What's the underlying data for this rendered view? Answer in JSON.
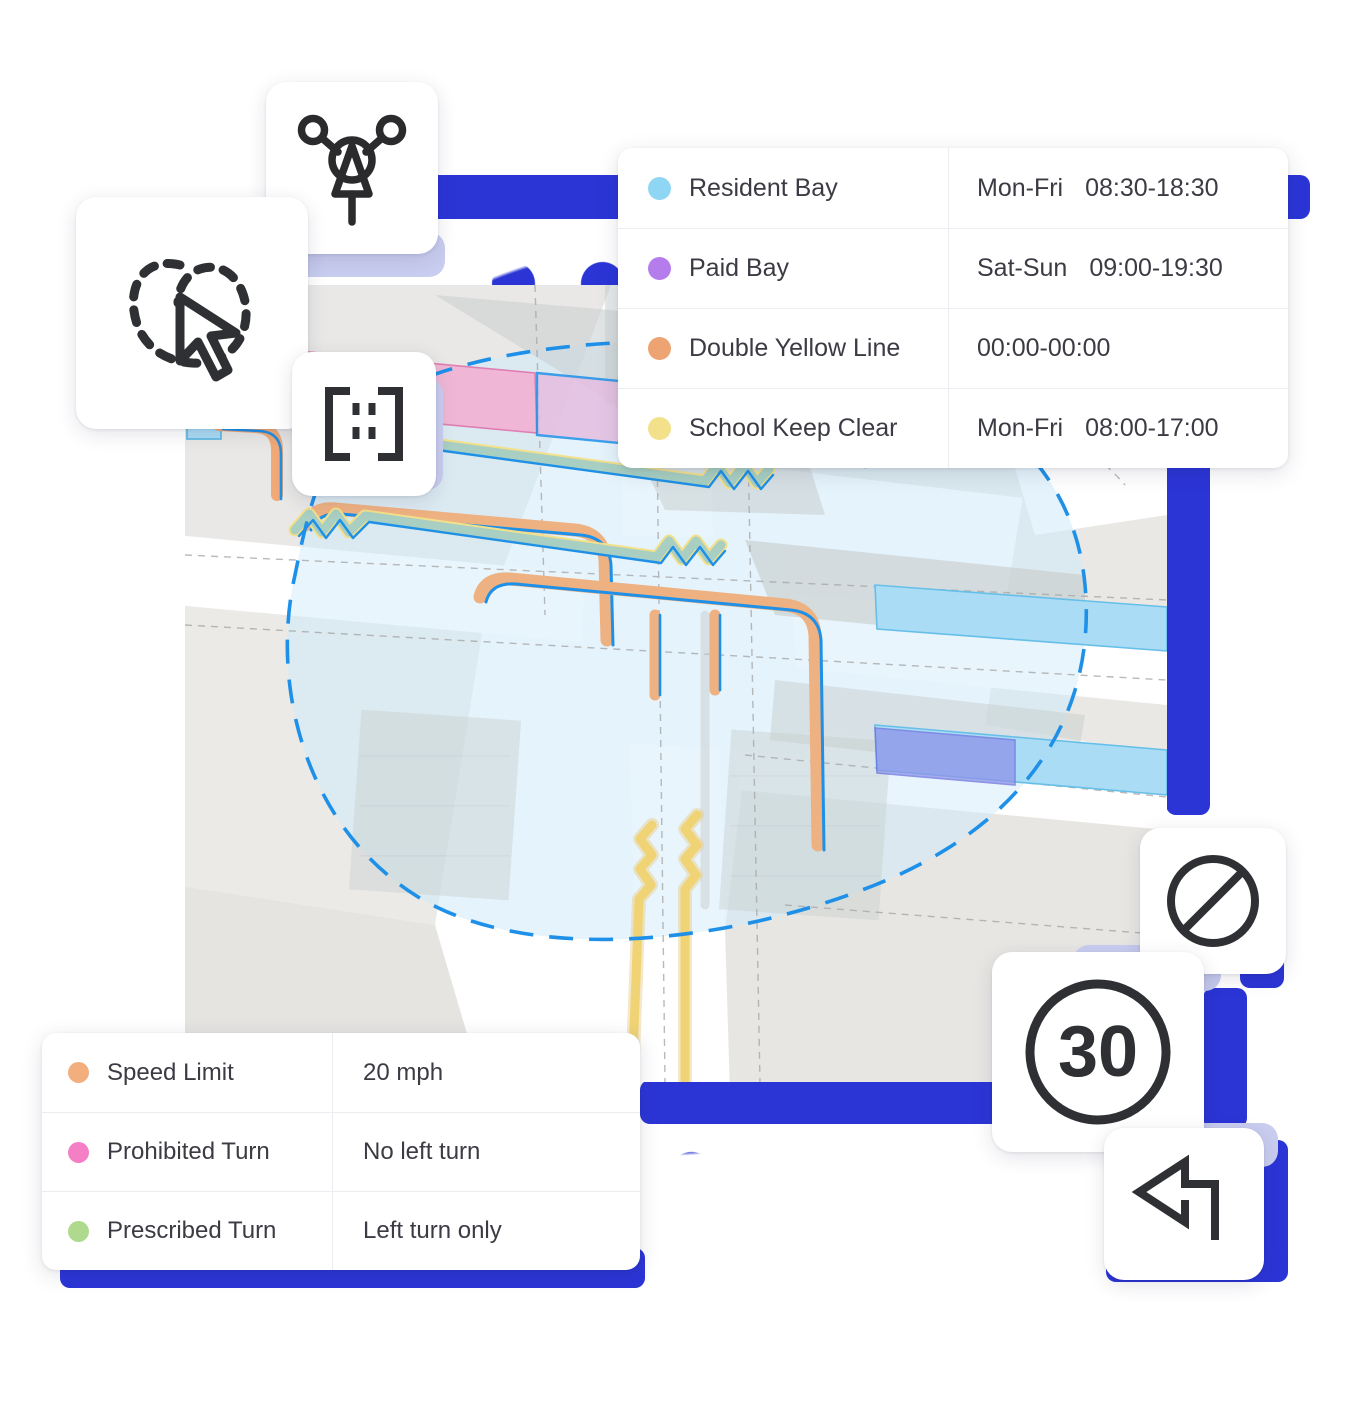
{
  "theme": {
    "accent_blue": "#2B35D6",
    "accent_lavender": "#C9CDEF",
    "card_bg": "#FFFFFF",
    "text": "#3B3B44"
  },
  "legend_parking": {
    "name": "Parking restriction legend",
    "rows": [
      {
        "color": "#8FD6F4",
        "label": "Resident Bay",
        "days": "Mon-Fri",
        "time": "08:30-18:30"
      },
      {
        "color": "#B57CEB",
        "label": "Paid Bay",
        "days": "Sat-Sun",
        "time": "09:00-19:30"
      },
      {
        "color": "#EDA472",
        "label": "Double Yellow Line",
        "days": "",
        "time": "00:00-00:00"
      },
      {
        "color": "#F3E08A",
        "label": "School Keep Clear",
        "days": "Mon-Fri",
        "time": "08:00-17:00"
      }
    ]
  },
  "legend_rules": {
    "name": "Traffic rule legend",
    "rows": [
      {
        "color": "#F3AE7E",
        "label": "Speed Limit",
        "value": "20 mph"
      },
      {
        "color": "#F57FC4",
        "label": "Prohibited Turn",
        "value": "No left turn"
      },
      {
        "color": "#AFD98C",
        "label": "Prescribed Turn",
        "value": "Left turn only"
      }
    ]
  },
  "icon_tiles": [
    {
      "icon": "junction-node-icon",
      "label": "Junction node tool"
    },
    {
      "icon": "lasso-select-icon",
      "label": "Lasso select tool"
    },
    {
      "icon": "lane-marking-icon",
      "label": "Lane marking tool"
    },
    {
      "icon": "no-entry-icon",
      "label": "Prohibition sign"
    },
    {
      "icon": "speed-limit-30-icon",
      "label": "Speed limit sign",
      "value": "30"
    },
    {
      "icon": "turn-left-arrow-icon",
      "label": "Left turn arrow"
    }
  ],
  "map": {
    "name": "Street intersection map",
    "selection_boundary": "dashed",
    "selection_color": "#1E90E8"
  }
}
